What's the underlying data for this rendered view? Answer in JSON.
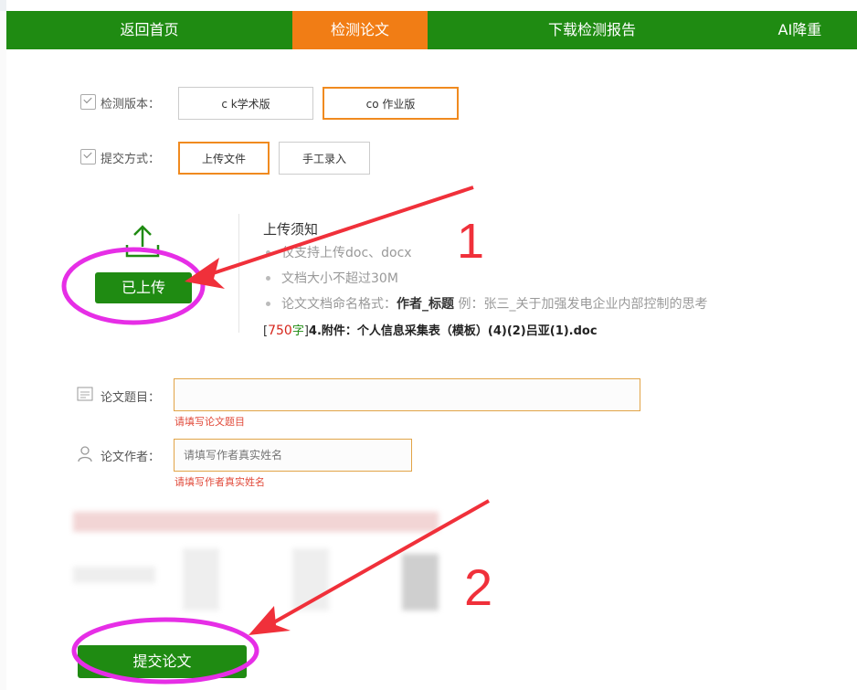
{
  "nav": {
    "tabs": [
      {
        "label": "返回首页",
        "active": false
      },
      {
        "label": "检测论文",
        "active": true
      },
      {
        "label": "下载检测报告",
        "active": false
      },
      {
        "label": "AI降重",
        "active": false
      }
    ]
  },
  "version": {
    "label": "检测版本：",
    "options": [
      {
        "label": "c      k学术版",
        "selected": false
      },
      {
        "label": "co       作业版",
        "selected": true
      }
    ]
  },
  "submit_method": {
    "label": "提交方式：",
    "options": [
      {
        "label": "上传文件",
        "selected": true
      },
      {
        "label": "手工录入",
        "selected": false
      }
    ]
  },
  "upload": {
    "button_label": "已上传",
    "notice_title": "上传须知",
    "notes": [
      {
        "text": "仅支持上传doc、docx"
      },
      {
        "text": "文档大小不超过30M"
      },
      {
        "prefix": "论文文档命名格式：",
        "bold": "作者_标题",
        "suffix": " 例：张三_关于加强发电企业内部控制的思考"
      }
    ],
    "file": {
      "open": "[",
      "count": "750",
      "unit": "字",
      "close": "]",
      "name": "4.附件：个人信息采集表（模板）(4)(2)吕亚(1).doc"
    }
  },
  "form": {
    "title_label": "论文题目：",
    "title_value": "",
    "title_error": "请填写论文题目",
    "author_label": "论文作者：",
    "author_placeholder": "请填写作者真实姓名",
    "author_error": "请填写作者真实姓名"
  },
  "submit": {
    "label": "提交论文"
  },
  "annotations": {
    "mark1": "1",
    "mark2": "2"
  },
  "colors": {
    "nav_green": "#1f8b12",
    "active_orange": "#f17d15",
    "annotation_red": "#f0303a",
    "annotation_magenta": "#e62ee6"
  }
}
